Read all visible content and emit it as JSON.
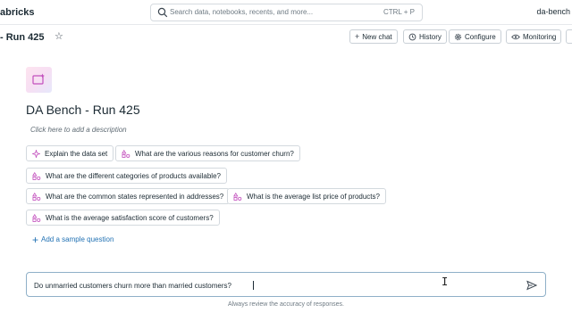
{
  "topbar": {
    "brand": "abricks",
    "search_placeholder": "Search data, notebooks, recents, and more...",
    "search_shortcut": "CTRL + P",
    "user": "da-bench"
  },
  "header": {
    "title": "- Run 425",
    "buttons": {
      "new_chat": "New chat",
      "history": "History",
      "configure": "Configure",
      "monitoring": "Monitoring"
    }
  },
  "main": {
    "space_title": "DA Bench - Run 425",
    "description_placeholder": "Click here to add a description",
    "sample_questions": [
      "Explain the data set",
      "What are the various reasons for customer churn?",
      "What are the different categories of products available?",
      "What are the common states represented in addresses?",
      "What is the average list price of products?",
      "What is the average satisfaction score of customers?"
    ],
    "add_sample_question": "Add a sample question"
  },
  "chat": {
    "input_value": "Do unmarried customers churn more than married customers?",
    "disclaimer": "Always review the accuracy of responses."
  },
  "colors": {
    "link": "#2272b4",
    "sparkle": "#c24fbd"
  }
}
